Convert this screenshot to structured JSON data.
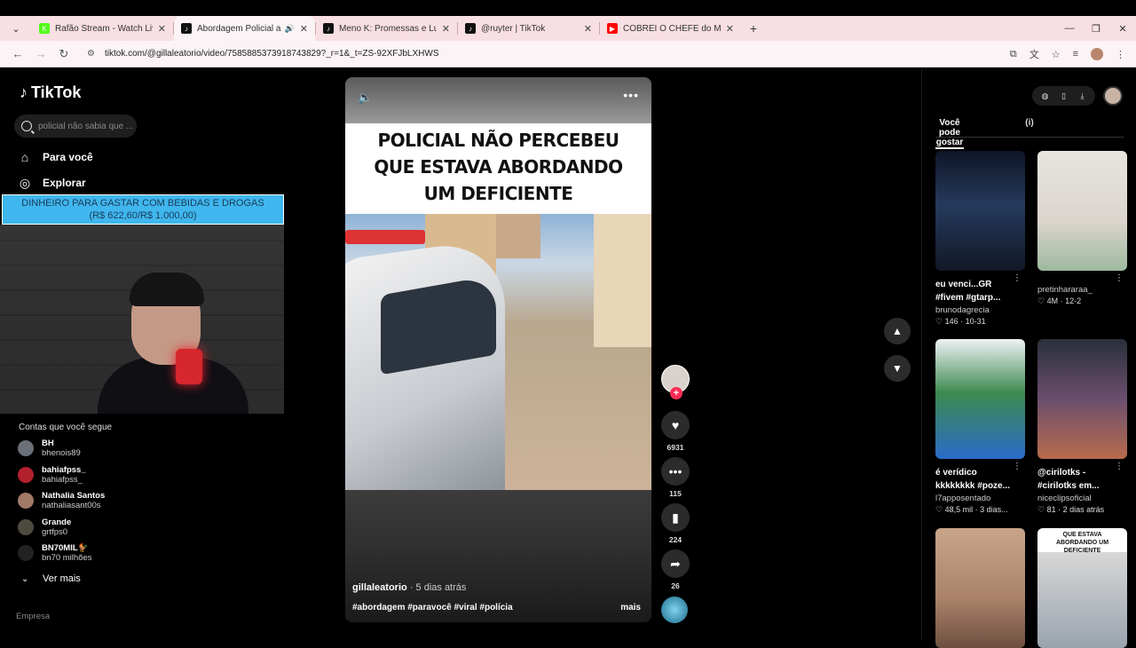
{
  "browser": {
    "tabs": [
      {
        "title": "Rafão Stream - Watch Live on K",
        "favicon_color": "#53fc18",
        "favicon_glyph": "K",
        "active": false
      },
      {
        "title": "Abordagem Policial a Defici",
        "favicon_color": "#111111",
        "favicon_glyph": "♪",
        "active": true,
        "audio": true
      },
      {
        "title": "Meno K: Promessas e Lutas no",
        "favicon_color": "#111111",
        "favicon_glyph": "♪",
        "active": false
      },
      {
        "title": "@ruyter | TikTok",
        "favicon_color": "#111111",
        "favicon_glyph": "♪",
        "active": false
      },
      {
        "title": "COBREI O CHEFE do MORRO",
        "favicon_color": "#ff0000",
        "favicon_glyph": "▶",
        "active": false
      }
    ],
    "url": "tiktok.com/@gillaleatorio/video/7585885373918743829?_r=1&_t=ZS-92XFJbLXHWS"
  },
  "sidebar": {
    "logo": "TikTok",
    "search_placeholder": "policial não sabia que ...",
    "nav": [
      {
        "label": "Para você",
        "icon": "home-icon"
      },
      {
        "label": "Explorar",
        "icon": "compass-icon"
      }
    ],
    "following_title": "Contas que você segue",
    "accounts": [
      {
        "name": "BH",
        "handle": "bhenois89",
        "color": "#6a6f78"
      },
      {
        "name": "bahiafpss_",
        "handle": "bahiafpss_",
        "color": "#b21f2d"
      },
      {
        "name": "Nathalia Santos",
        "handle": "nathaliasant00s",
        "color": "#a07a66"
      },
      {
        "name": "Grande",
        "handle": "grtfps0",
        "color": "#4d4a3f"
      },
      {
        "name": "BN70MIL🐓",
        "handle": "bn70 milhões",
        "color": "#222222"
      }
    ],
    "see_more": "Ver mais",
    "company": "Empresa"
  },
  "overlay": {
    "line1": "DINHEIRO PARA GASTAR COM BEBIDAS E DROGAS",
    "line2": "(R$ 622,60/R$ 1.000,00)"
  },
  "video": {
    "caption_lines": [
      "POLICIAL NÃO PERCEBEU",
      "QUE ESTAVA ABORDANDO",
      "UM DEFICIENTE"
    ],
    "author": "gillaleatorio",
    "time_ago": "· 5 dias atrás",
    "tags": "#abordagem #paravocê #viral #polícia",
    "more": "mais"
  },
  "actions": {
    "likes": "6931",
    "comments": "115",
    "saves": "224",
    "shares": "26"
  },
  "right_panel": {
    "tabs": [
      "(i)",
      "Você pode gostar"
    ],
    "cards": [
      {
        "title": "eu venci...GR",
        "title2": "#fivem #gtarp...",
        "user": "brunodagrecia",
        "meta": "♡ 146 · 10-31",
        "bg": "linear-gradient(180deg,#0e1526,#253a5c 45%,#111827)"
      },
      {
        "title": "",
        "title2": "",
        "user": "pretinhararaa_",
        "meta": "♡ 4M · 12-2",
        "bg": "linear-gradient(180deg,#e8e5e0,#d9d4cc 60%,#9db99d)"
      },
      {
        "title": "é verídico",
        "title2": "kkkkkkkk #poze...",
        "user": "l7apposentado",
        "meta": "♡ 48,5 mil · 3 dias...",
        "bg": "linear-gradient(180deg,#eef2f5,#3d8a4f 45%,#2a6bc9)"
      },
      {
        "title": "@cirilotks -",
        "title2": "#cirilotks em...",
        "user": "niceclipsoficial",
        "meta": "♡ 81 · 2 dias atrás",
        "bg": "linear-gradient(180deg,#2a2f3a,#6b4f6e 50%,#b86b4c)"
      },
      {
        "title": "",
        "title2": "",
        "user": "",
        "meta": "",
        "bg": "linear-gradient(180deg,#c8a58a,#a9816a 60%,#6d4f40)"
      },
      {
        "title": "",
        "title2": "",
        "user": "",
        "meta": "",
        "overlay": "QUE ESTAVA ABORDANDO UM DEFICIENTE",
        "bg": "linear-gradient(180deg,#ffffff 0%,#ffffff 20%,#d7d7d7 20%,#9aa3ad 100%)"
      }
    ]
  }
}
